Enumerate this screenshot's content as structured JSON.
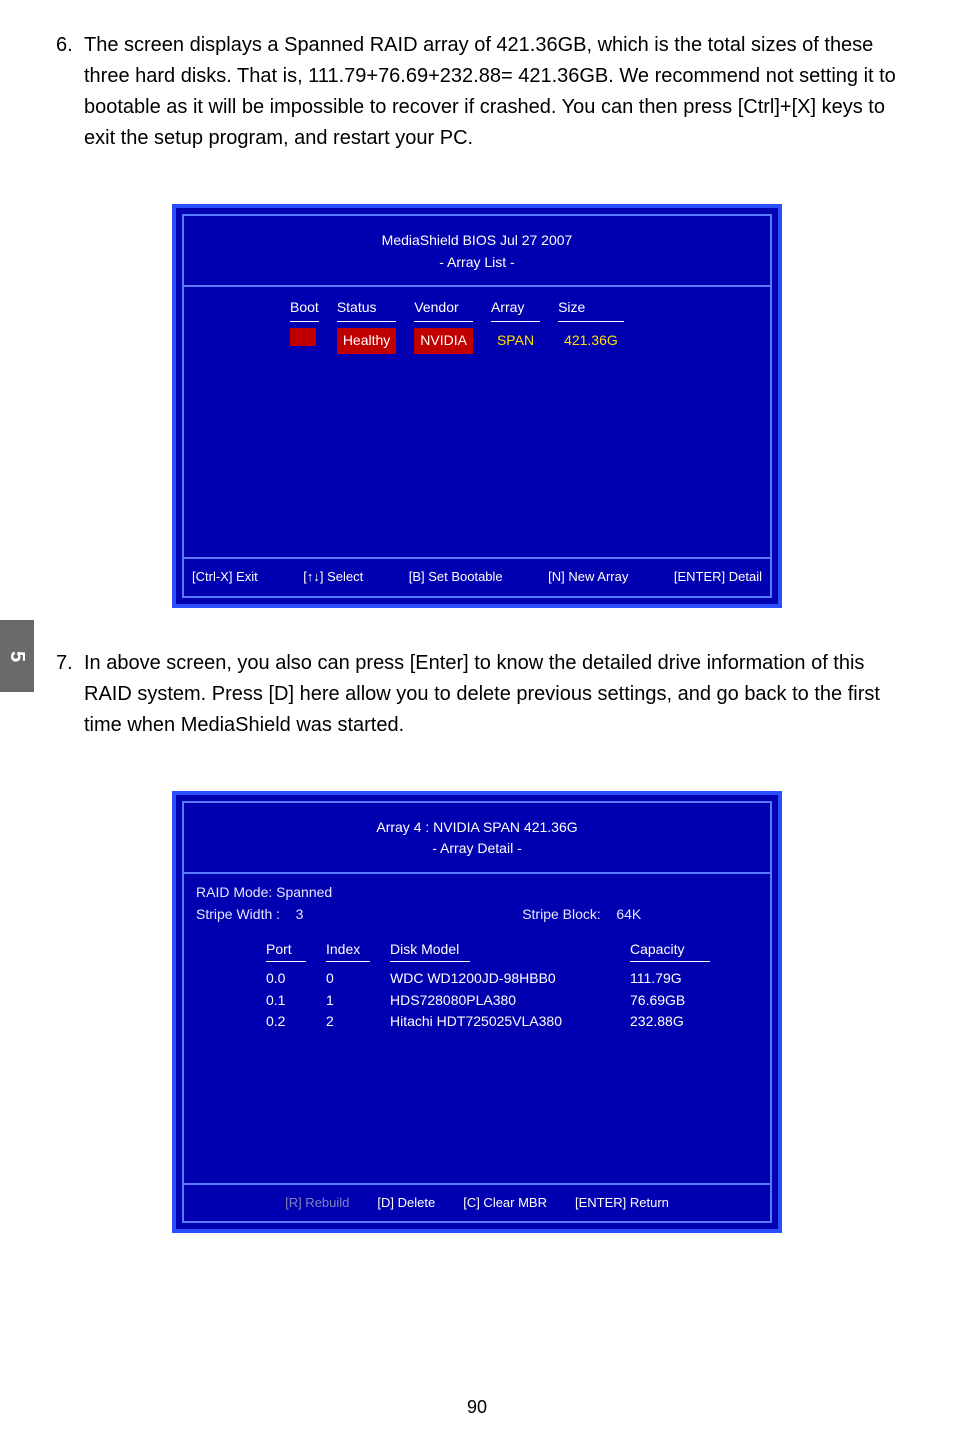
{
  "sideTab": "5",
  "step6": {
    "number": "6.",
    "text": "The screen displays a Spanned RAID array of 421.36GB, which is the total sizes of these three hard disks. That is, 111.79+76.69+232.88= 421.36GB. We recommend not setting it to bootable as it will be impossible to recover if crashed. You can then press [Ctrl]+[X] keys to exit the setup program, and restart your PC."
  },
  "bios1": {
    "titleLine1": "MediaShield BIOS   Jul 27 2007",
    "titleLine2": "- Array List -",
    "headers": {
      "boot": "Boot",
      "status": "Status",
      "vendor": "Vendor",
      "array": "Array",
      "size": "Size"
    },
    "row": {
      "status": "Healthy",
      "vendor": "NVIDIA",
      "array": "SPAN",
      "size": "421.36G"
    },
    "footer": {
      "exit": "[Ctrl-X] Exit",
      "select": "[↑↓] Select",
      "boot": "[B] Set Bootable",
      "newarr": "[N] New Array",
      "detail": "[ENTER] Detail"
    }
  },
  "step7": {
    "number": "7.",
    "text": "In above screen, you also can press [Enter] to know the detailed drive information of this RAID system. Press [D] here allow you to delete previous settings, and go back to the first time when MediaShield was started."
  },
  "bios2": {
    "titleLine1": "Array 4 : NVIDIA   SPAN   421.36G",
    "titleLine2": "- Array Detail -",
    "raidModeLabel": "RAID Mode: Spanned",
    "stripeWidthLabel": "Stripe Width :",
    "stripeWidthValue": "3",
    "stripeBlockLabel": "Stripe Block:",
    "stripeBlockValue": "64K",
    "headers": {
      "port": "Port",
      "index": "Index",
      "model": "Disk Model",
      "capacity": "Capacity"
    },
    "rows": [
      {
        "port": "0.0",
        "index": "0",
        "model": "WDC WD1200JD-98HBB0",
        "capacity": "111.79G"
      },
      {
        "port": "0.1",
        "index": "1",
        "model": "HDS728080PLA380",
        "capacity": "76.69GB"
      },
      {
        "port": "0.2",
        "index": "2",
        "model": "Hitachi HDT725025VLA380",
        "capacity": "232.88G"
      }
    ],
    "footer": {
      "rebuild": "[R] Rebuild",
      "delete": "[D] Delete",
      "clear": "[C] Clear MBR",
      "ret": "[ENTER] Return"
    }
  },
  "pageNumber": "90"
}
